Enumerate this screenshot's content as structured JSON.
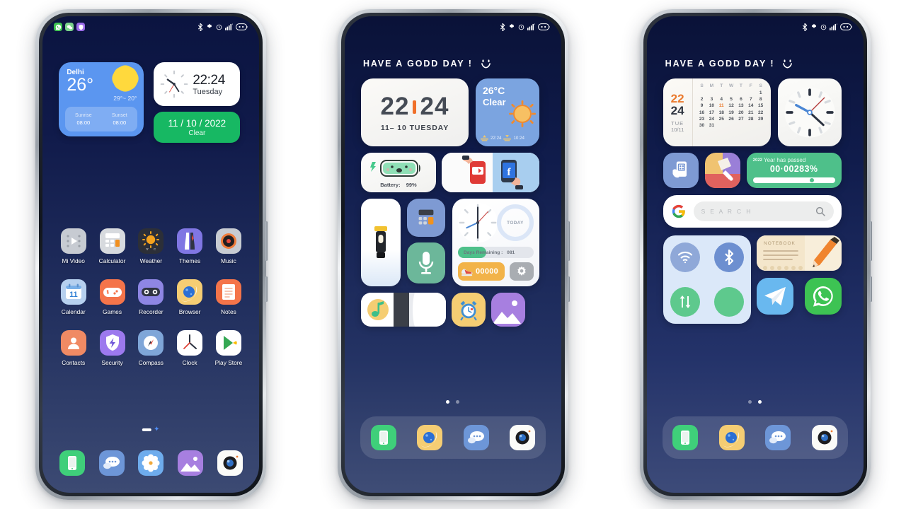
{
  "colors": {
    "accent_green": "#17b863",
    "accent_blue": "#5b96f0",
    "accent_orange": "#f0702a",
    "wallpaper_top": "#0b1440",
    "wallpaper_bottom": "#3c4a73"
  },
  "phone1": {
    "statusbar": {
      "notifications": [
        "whatsapp-icon",
        "wechat-icon",
        "security-icon"
      ],
      "system": [
        "bluetooth-icon",
        "nfc-icon",
        "alarm-icon",
        "signal-icon",
        "battery-icon"
      ]
    },
    "weather_widget": {
      "city": "Delhi",
      "temp": "26°",
      "range": "29°~ 20°",
      "sunrise_label": "Sunrise",
      "sunrise_value": "08:00",
      "sunset_label": "Sunset",
      "sunset_value": "08:00"
    },
    "clock_widget": {
      "time": "22:24",
      "day": "Tuesday"
    },
    "date_widget": {
      "date": "11 / 10 / 2022",
      "condition": "Clear"
    },
    "apps": [
      {
        "label": "Mi Video",
        "icon": "mi-video-icon"
      },
      {
        "label": "Calculator",
        "icon": "calculator-icon"
      },
      {
        "label": "Weather",
        "icon": "weather-icon"
      },
      {
        "label": "Themes",
        "icon": "themes-icon"
      },
      {
        "label": "Music",
        "icon": "music-icon"
      },
      {
        "label": "Calendar",
        "icon": "calendar-icon"
      },
      {
        "label": "Games",
        "icon": "games-icon"
      },
      {
        "label": "Recorder",
        "icon": "recorder-icon"
      },
      {
        "label": "Browser",
        "icon": "browser-icon"
      },
      {
        "label": "Notes",
        "icon": "notes-icon"
      },
      {
        "label": "Contacts",
        "icon": "contacts-icon"
      },
      {
        "label": "Security",
        "icon": "security-icon"
      },
      {
        "label": "Compass",
        "icon": "compass-icon"
      },
      {
        "label": "Clock",
        "icon": "clock-icon"
      },
      {
        "label": "Play Store",
        "icon": "play-store-icon"
      }
    ],
    "calendar_app_day": "11",
    "dock": [
      "phone-manager-icon",
      "messages-icon",
      "settings-icon",
      "gallery-icon",
      "camera-icon"
    ]
  },
  "phone2": {
    "greeting": "HAVE A GODD DAY !",
    "clock_widget": {
      "hours": "22",
      "minutes": "24",
      "sub": "11– 10  TUESDAY"
    },
    "weather_widget": {
      "temp": "26°C",
      "condition": "Clear",
      "sunrise": "22:24",
      "sunset": "10:24"
    },
    "battery_widget": {
      "label": "Battery:",
      "value": "99%"
    },
    "social_widget": [
      "youtube-icon",
      "facebook-icon"
    ],
    "utility_widgets": [
      "flashlight-icon",
      "calculator-icon",
      "recorder-icon"
    ],
    "panel_widget": {
      "today_label": "TODAY",
      "days_label": "Days Remaining :",
      "days_value": "081",
      "counter": "00000",
      "gear": "gear-icon"
    },
    "bottom_widgets": [
      "music-icon",
      "alarm-icon",
      "gallery-icon"
    ],
    "page_dots": {
      "count": 2,
      "active": 0
    },
    "dock": [
      "phone-manager-icon",
      "browser-icon",
      "messages-icon",
      "camera-icon"
    ]
  },
  "phone3": {
    "greeting": "HAVE A GODD DAY !",
    "calendar_widget": {
      "hours": "22",
      "minutes": "24",
      "weekday": "TUE",
      "date": "10/11",
      "weekday_headers": [
        "S",
        "M",
        "T",
        "W",
        "T",
        "F",
        "S"
      ],
      "weeks": [
        [
          "",
          "",
          "",
          "",
          "",
          "",
          "1"
        ],
        [
          "2",
          "3",
          "4",
          "5",
          "6",
          "7",
          "8"
        ],
        [
          "9",
          "10",
          "11",
          "12",
          "13",
          "14",
          "15"
        ],
        [
          "16",
          "17",
          "18",
          "19",
          "20",
          "21",
          "22"
        ],
        [
          "23",
          "24",
          "25",
          "26",
          "27",
          "28",
          "29"
        ],
        [
          "30",
          "31",
          "",
          "",
          "",
          "",
          ""
        ]
      ],
      "highlighted_day": "11"
    },
    "shortcut_widgets": [
      "scanner-icon",
      "themes-icon"
    ],
    "year_widget": {
      "year": "2022",
      "label": "Year has passed",
      "percent": "00·00283%",
      "progress": 72
    },
    "search_widget": {
      "engine": "google-icon",
      "placeholder": "S E A R C H",
      "action": "search-icon"
    },
    "toggles": [
      "wifi-icon",
      "bluetooth-icon",
      "mobile-data-icon",
      "blank-toggle-icon"
    ],
    "note_widget": {
      "title": "NOTEBOOK",
      "icon": "pencil-icon"
    },
    "messenger_widgets": [
      "telegram-icon",
      "whatsapp-icon"
    ],
    "page_dots": {
      "count": 2,
      "active": 1
    },
    "dock": [
      "phone-manager-icon",
      "browser-icon",
      "messages-icon",
      "camera-icon"
    ]
  }
}
